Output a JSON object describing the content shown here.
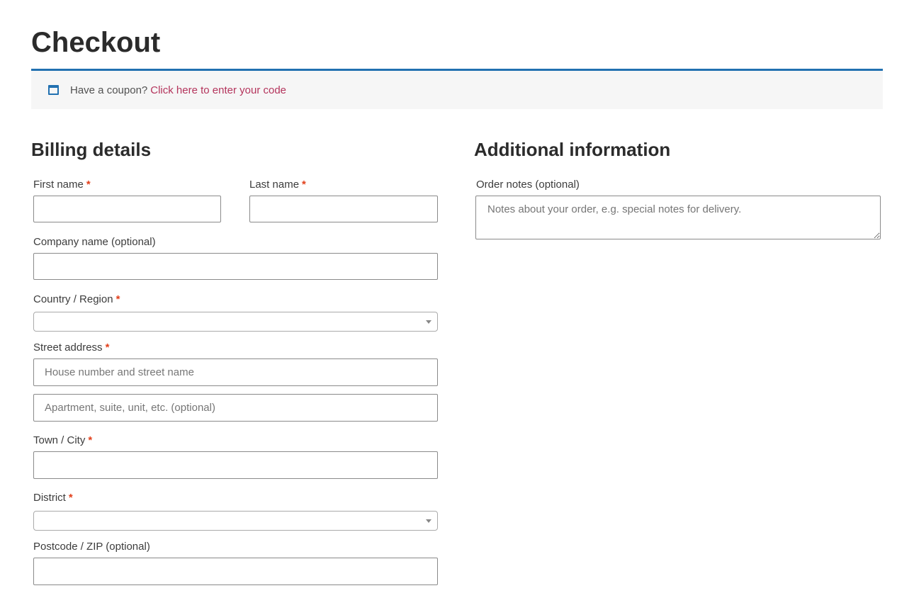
{
  "page": {
    "title": "Checkout"
  },
  "coupon": {
    "icon": "window-icon",
    "text": "Have a coupon?",
    "link": "Click here to enter your code"
  },
  "billing": {
    "heading": "Billing details",
    "first_name": {
      "label": "First name",
      "required": "*",
      "value": "",
      "placeholder": ""
    },
    "last_name": {
      "label": "Last name",
      "required": "*",
      "value": "",
      "placeholder": ""
    },
    "company": {
      "label": "Company name (optional)",
      "value": "",
      "placeholder": ""
    },
    "country": {
      "label": "Country / Region",
      "required": "*",
      "value": ""
    },
    "street": {
      "label": "Street address",
      "required": "*",
      "line1_placeholder": "House number and street name",
      "line2_placeholder": "Apartment, suite, unit, etc. (optional)"
    },
    "city": {
      "label": "Town / City",
      "required": "*",
      "value": ""
    },
    "district": {
      "label": "District",
      "required": "*",
      "value": ""
    },
    "postcode": {
      "label": "Postcode / ZIP (optional)",
      "value": ""
    }
  },
  "additional": {
    "heading": "Additional information",
    "order_notes": {
      "label": "Order notes (optional)",
      "placeholder": "Notes about your order, e.g. special notes for delivery."
    }
  },
  "colors": {
    "accent": "#2271b1",
    "link": "#b4345c",
    "required": "#e2401c"
  }
}
